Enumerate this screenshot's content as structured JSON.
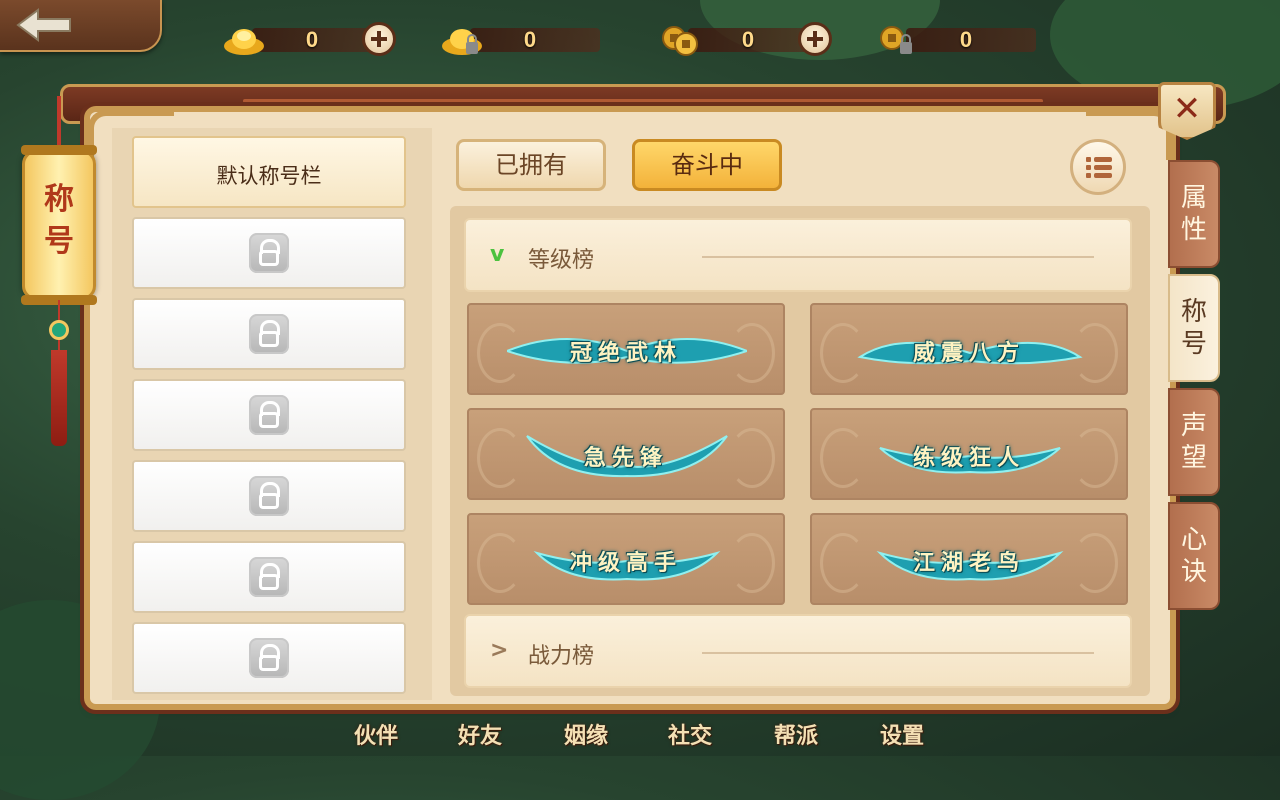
{
  "currencies": [
    {
      "icon": "gold-ingot-icon",
      "value": "0",
      "has_plus": true
    },
    {
      "icon": "locked-gold-ingot-icon",
      "value": "0",
      "has_plus": false
    },
    {
      "icon": "copper-coin-icon",
      "value": "0",
      "has_plus": true
    },
    {
      "icon": "locked-copper-coin-icon",
      "value": "0",
      "has_plus": false
    }
  ],
  "lantern_label": "称号",
  "slots": {
    "default_label": "默认称号栏",
    "locked_count": 6
  },
  "tabs": {
    "owned": "已拥有",
    "striving": "奋斗中"
  },
  "sections": [
    {
      "label": "等级榜",
      "expanded": true,
      "chevron": "v",
      "chevron_color": "#4cc23f"
    },
    {
      "label": "战力榜",
      "expanded": false,
      "chevron": ">",
      "chevron_color": "#9a7a5a"
    }
  ],
  "titles": [
    {
      "text": "冠绝武林"
    },
    {
      "text": "威震八方"
    },
    {
      "text": "急先锋"
    },
    {
      "text": "练级狂人"
    },
    {
      "text": "冲级高手"
    },
    {
      "text": "江湖老鸟"
    }
  ],
  "side_tabs": [
    {
      "label": "属性",
      "active": false
    },
    {
      "label": "称号",
      "active": true
    },
    {
      "label": "声望",
      "active": false
    },
    {
      "label": "心诀",
      "active": false
    }
  ],
  "bottom_nav": [
    "伙伴",
    "好友",
    "姻缘",
    "社交",
    "帮派",
    "设置"
  ],
  "colors": {
    "accent_gold": "#f3b23a",
    "panel_bg": "#f1dfc0",
    "title_glow": "#2bd1d6"
  }
}
